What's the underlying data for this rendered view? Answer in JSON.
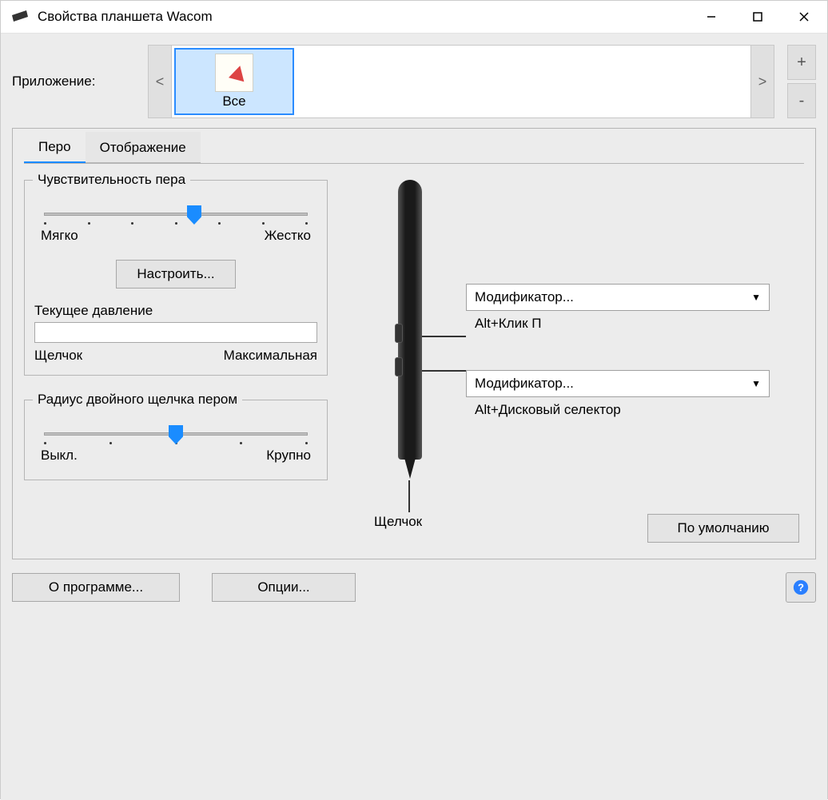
{
  "window": {
    "title": "Свойства планшета Wacom"
  },
  "app_row": {
    "label": "Приложение:",
    "items": [
      {
        "name": "Все"
      }
    ],
    "scroll_left": "<",
    "scroll_right": ">",
    "add": "+",
    "remove": "-"
  },
  "tabs": {
    "pen": "Перо",
    "mapping": "Отображение"
  },
  "pen_feel": {
    "group": "Чувствительность пера",
    "soft": "Мягко",
    "firm": "Жестко",
    "slider_pos_pct": 57,
    "customize": "Настроить...",
    "pressure_label": "Текущее давление",
    "click": "Щелчок",
    "max": "Максимальная"
  },
  "dbl_click": {
    "group": "Радиус двойного щелчка пером",
    "off": "Выкл.",
    "large": "Крупно",
    "slider_pos_pct": 50
  },
  "pen_side": {
    "tip_label": "Щелчок",
    "upper": {
      "value": "Модификатор...",
      "sub": "Alt+Клик П"
    },
    "lower": {
      "value": "Модификатор...",
      "sub": "Alt+Дисковый селектор"
    }
  },
  "default_btn": "По умолчанию",
  "bottom": {
    "about": "О программе...",
    "options": "Опции..."
  }
}
